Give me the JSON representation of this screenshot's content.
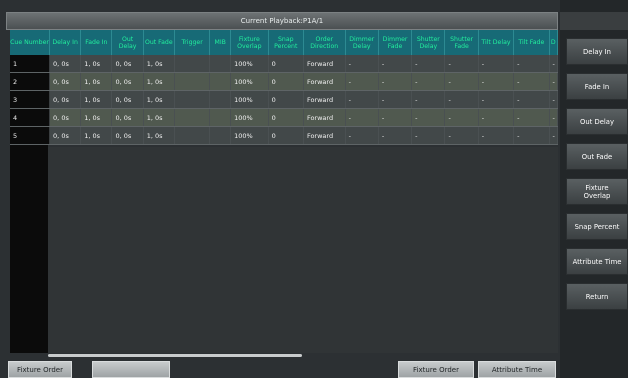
{
  "title": "Current Playback:P1A/1",
  "columns": [
    "Cue Number",
    "Delay In",
    "Fade In",
    "Out Delay",
    "Out Fade",
    "Trigger",
    "MIB",
    "Fixture Overlap",
    "Snap Percent",
    "Order Direction",
    "Dimmer Delay",
    "Dimmer Fade",
    "Shutter Delay",
    "Shutter Fade",
    "Tilt Delay",
    "Tilt Fade",
    "D"
  ],
  "rows": [
    [
      "1",
      "0, 0s",
      "1, 0s",
      "0, 0s",
      "1, 0s",
      "",
      "",
      "100%",
      "0",
      "Forward",
      "-",
      "-",
      "-",
      "-",
      "-",
      "-",
      "-"
    ],
    [
      "2",
      "0, 0s",
      "1, 0s",
      "0, 0s",
      "1, 0s",
      "",
      "",
      "100%",
      "0",
      "Forward",
      "-",
      "-",
      "-",
      "-",
      "-",
      "-",
      "-"
    ],
    [
      "3",
      "0, 0s",
      "1, 0s",
      "0, 0s",
      "1, 0s",
      "",
      "",
      "100%",
      "0",
      "Forward",
      "-",
      "-",
      "-",
      "-",
      "-",
      "-",
      "-"
    ],
    [
      "4",
      "0, 0s",
      "1, 0s",
      "0, 0s",
      "1, 0s",
      "",
      "",
      "100%",
      "0",
      "Forward",
      "-",
      "-",
      "-",
      "-",
      "-",
      "-",
      "-"
    ],
    [
      "5",
      "0, 0s",
      "1, 0s",
      "0, 0s",
      "1, 0s",
      "",
      "",
      "100%",
      "0",
      "Forward",
      "-",
      "-",
      "-",
      "-",
      "-",
      "-",
      "-"
    ]
  ],
  "sidebar": {
    "buttons": [
      "Delay In",
      "Fade In",
      "Out Delay",
      "Out Fade",
      "Fixture\nOverlap",
      "Snap Percent",
      "Attribute Time",
      "Return"
    ]
  },
  "bottom": {
    "left_button": "Fixture Order",
    "blank_button": "",
    "right_button_1": "Fixture Order",
    "right_button_2": "Attribute Time"
  }
}
